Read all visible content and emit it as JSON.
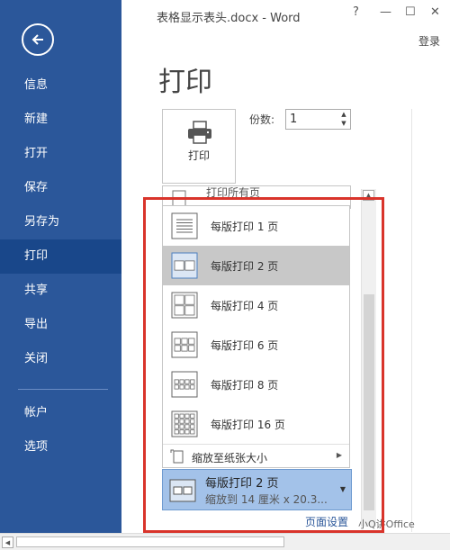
{
  "window": {
    "title": "表格显示表头.docx - Word",
    "help": "?",
    "minimize": "—",
    "maximize": "☐",
    "close": "✕",
    "login": "登录"
  },
  "sidebar": {
    "items": [
      {
        "label": "信息"
      },
      {
        "label": "新建"
      },
      {
        "label": "打开"
      },
      {
        "label": "保存"
      },
      {
        "label": "另存为"
      },
      {
        "label": "打印"
      },
      {
        "label": "共享"
      },
      {
        "label": "导出"
      },
      {
        "label": "关闭"
      },
      {
        "label": "帐户"
      },
      {
        "label": "选项"
      }
    ],
    "active": "打印"
  },
  "print": {
    "heading": "打印",
    "button_label": "打印",
    "copies_label": "份数:",
    "copies_value": "1",
    "print_all_label": "打印所有页"
  },
  "dropdown": {
    "items": [
      {
        "label": "每版打印 1 页",
        "grid": [
          1,
          1
        ]
      },
      {
        "label": "每版打印 2 页",
        "grid": [
          2,
          1
        ]
      },
      {
        "label": "每版打印 4 页",
        "grid": [
          2,
          2
        ]
      },
      {
        "label": "每版打印 6 页",
        "grid": [
          3,
          2
        ]
      },
      {
        "label": "每版打印 8 页",
        "grid": [
          4,
          2
        ]
      },
      {
        "label": "每版打印 16 页",
        "grid": [
          4,
          4
        ]
      }
    ],
    "selected_index": 1,
    "scale_label": "缩放至纸张大小"
  },
  "pages_combo": {
    "main": "每版打印 2 页",
    "sub": "缩放到 14 厘米 x 20.3..."
  },
  "page_setup": "页面设置",
  "watermark": "小Q讲Office",
  "colors": {
    "sidebar": "#2b579a",
    "sidebar_active": "#19478a",
    "highlight": "#d9342b",
    "combo_selected": "#a3c2e9"
  }
}
